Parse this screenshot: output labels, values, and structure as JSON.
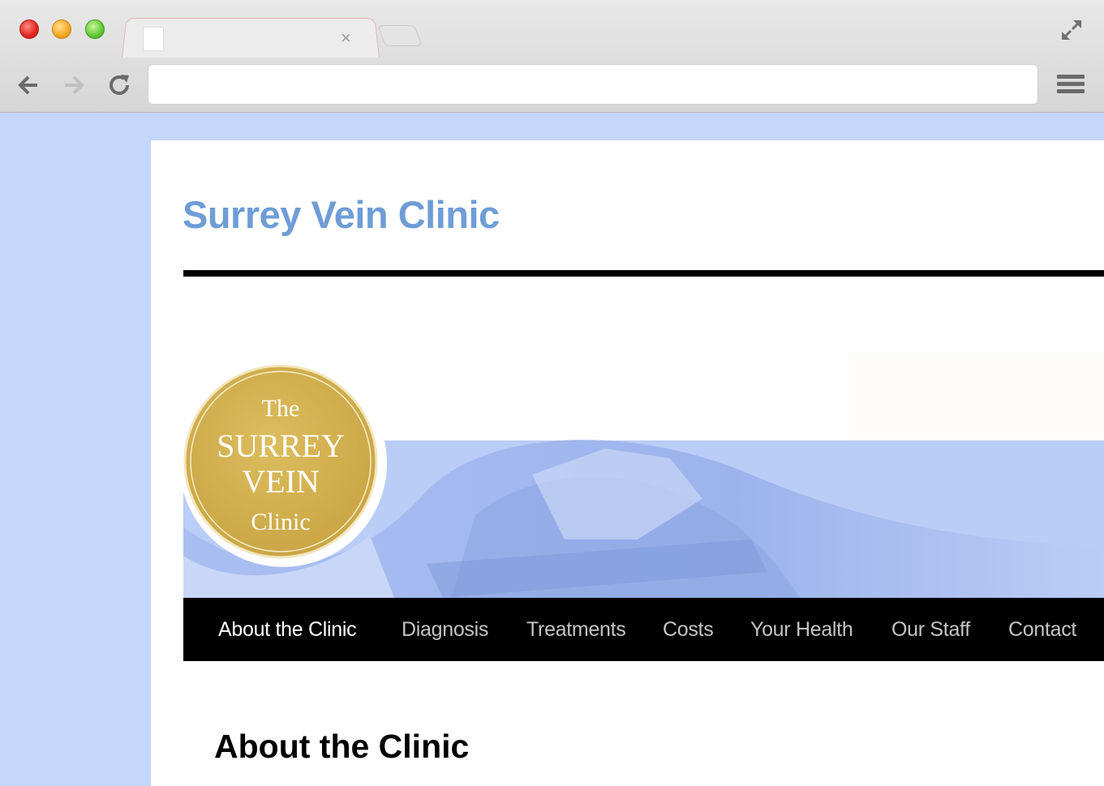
{
  "browser": {
    "tab": {
      "title": "",
      "close_glyph": "×"
    },
    "url": "",
    "icons": {
      "back": "back-arrow-icon",
      "forward": "forward-arrow-icon",
      "reload": "reload-icon",
      "menu": "hamburger-menu-icon",
      "fullscreen": "fullscreen-icon"
    }
  },
  "site": {
    "title": "Surrey Vein Clinic",
    "logo": {
      "line1": "The",
      "line2": "SURREY",
      "line3": "VEIN",
      "line4": "Clinic"
    },
    "nav": [
      {
        "label": "About the Clinic",
        "active": true
      },
      {
        "label": "Diagnosis",
        "active": false
      },
      {
        "label": "Treatments",
        "active": false
      },
      {
        "label": "Costs",
        "active": false
      },
      {
        "label": "Your Health",
        "active": false
      },
      {
        "label": "Our Staff",
        "active": false
      },
      {
        "label": "Contact",
        "active": false
      }
    ],
    "section_heading": "About the Clinic"
  },
  "colors": {
    "page_background": "#c5d6fb",
    "title": "#6e9dd6",
    "logo_gold": "#d4b24f",
    "banner_blue": "#b9cdf6",
    "navbar": "#000000"
  }
}
